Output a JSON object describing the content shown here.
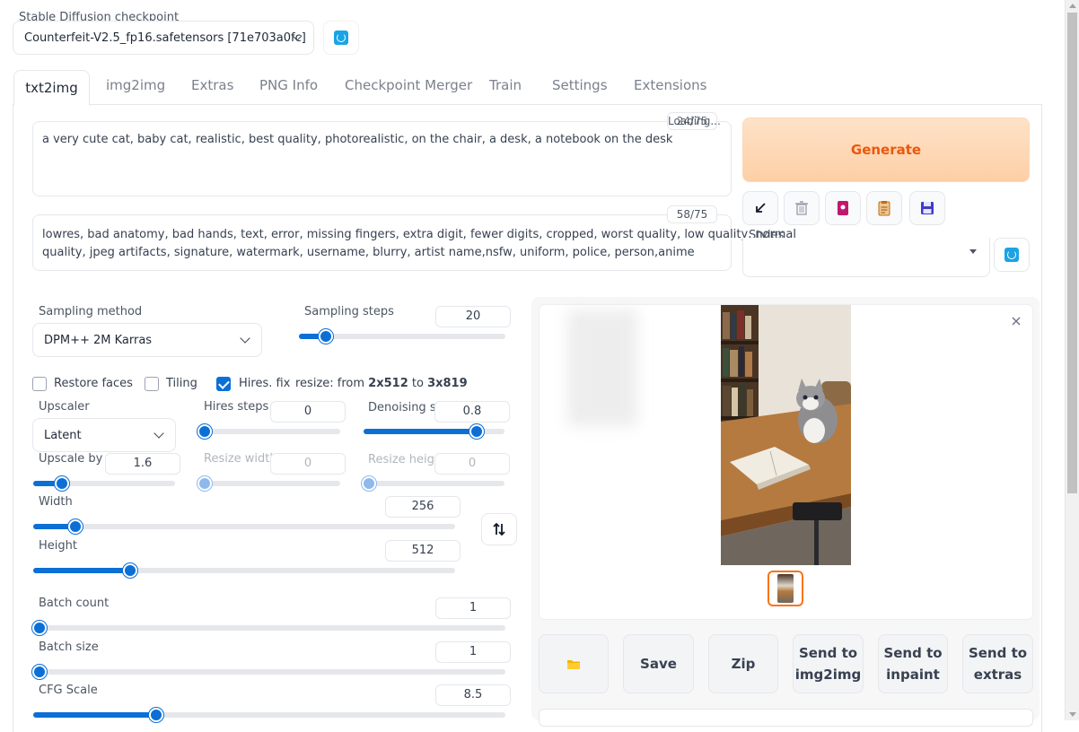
{
  "checkpoint": {
    "label": "Stable Diffusion checkpoint",
    "value": "Counterfeit-V2.5_fp16.safetensors [71e703a0fc]"
  },
  "tabs": [
    "txt2img",
    "img2img",
    "Extras",
    "PNG Info",
    "Checkpoint Merger",
    "Train",
    "Settings",
    "Extensions"
  ],
  "prompt": {
    "text": "a very cute cat, baby cat, realistic, best quality, photorealistic, on the chair, a desk, a notebook on the desk",
    "counter": "24/75",
    "loading": "Loading..."
  },
  "negative": {
    "line1": "lowres, bad anatomy, bad hands, text, error, missing fingers, extra digit, fewer digits, cropped, worst quality, low quality, normal",
    "line2": "quality, jpeg artifacts, signature, watermark, username, blurry, artist name,nsfw, uniform, police, person,anime",
    "counter": "58/75"
  },
  "generate_label": "Generate",
  "styles_label": "Styles",
  "sampling": {
    "method_label": "Sampling method",
    "method_value": "DPM++ 2M Karras",
    "steps_label": "Sampling steps",
    "steps_value": "20",
    "steps_fraction": 0.13
  },
  "checkboxes": {
    "restore_faces": "Restore faces",
    "tiling": "Tiling",
    "hires_fix": "Hires. fix",
    "hires_checked": true
  },
  "resize_info": {
    "prefix": "resize: from ",
    "from": "2x512",
    "mid": " to ",
    "to": "3x819"
  },
  "hires": {
    "upscaler_label": "Upscaler",
    "upscaler_value": "Latent",
    "steps_label": "Hires steps",
    "steps_value": "0",
    "steps_fraction": 0.0,
    "denoise_label": "Denoising strength",
    "denoise_value": "0.8",
    "denoise_fraction": 0.8,
    "upscale_by_label": "Upscale by",
    "upscale_by_value": "1.6",
    "upscale_by_fraction": 0.2,
    "resize_width_label": "Resize width",
    "resize_width_value": "0",
    "resize_height_label": "Resize height",
    "resize_height_value": "0"
  },
  "size": {
    "width_label": "Width",
    "width_value": "256",
    "width_fraction": 0.1,
    "height_label": "Height",
    "height_value": "512",
    "height_fraction": 0.23
  },
  "batch": {
    "count_label": "Batch count",
    "count_value": "1",
    "count_fraction": 0.0,
    "size_label": "Batch size",
    "size_value": "1",
    "size_fraction": 0.0,
    "cfg_label": "CFG Scale",
    "cfg_value": "8.5",
    "cfg_fraction": 0.26
  },
  "actions": {
    "save": "Save",
    "zip": "Zip",
    "send_img2img": [
      "Send to",
      "img2img"
    ],
    "send_inpaint": [
      "Send to",
      "inpaint"
    ],
    "send_extras": [
      "Send to",
      "extras"
    ]
  },
  "colors": {
    "accent": "#0b6fd6",
    "generate_bg": "#fdd3ad",
    "generate_text": "#ea580c"
  }
}
